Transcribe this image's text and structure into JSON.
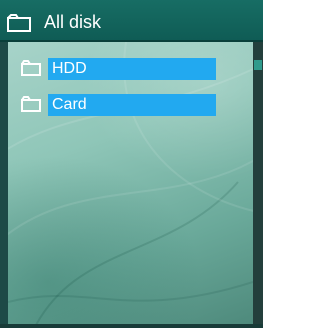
{
  "header": {
    "title": "All disk",
    "icon": "folder-icon"
  },
  "items": [
    {
      "label": "HDD",
      "icon": "folder-icon",
      "selected": true
    },
    {
      "label": "Card",
      "icon": "folder-icon",
      "selected": true
    }
  ],
  "colors": {
    "header_bg": "#176d64",
    "selection_bg": "#22a9f0",
    "panel_bg": "#8fc6b8",
    "scroll_thumb": "#2f9a8c"
  }
}
